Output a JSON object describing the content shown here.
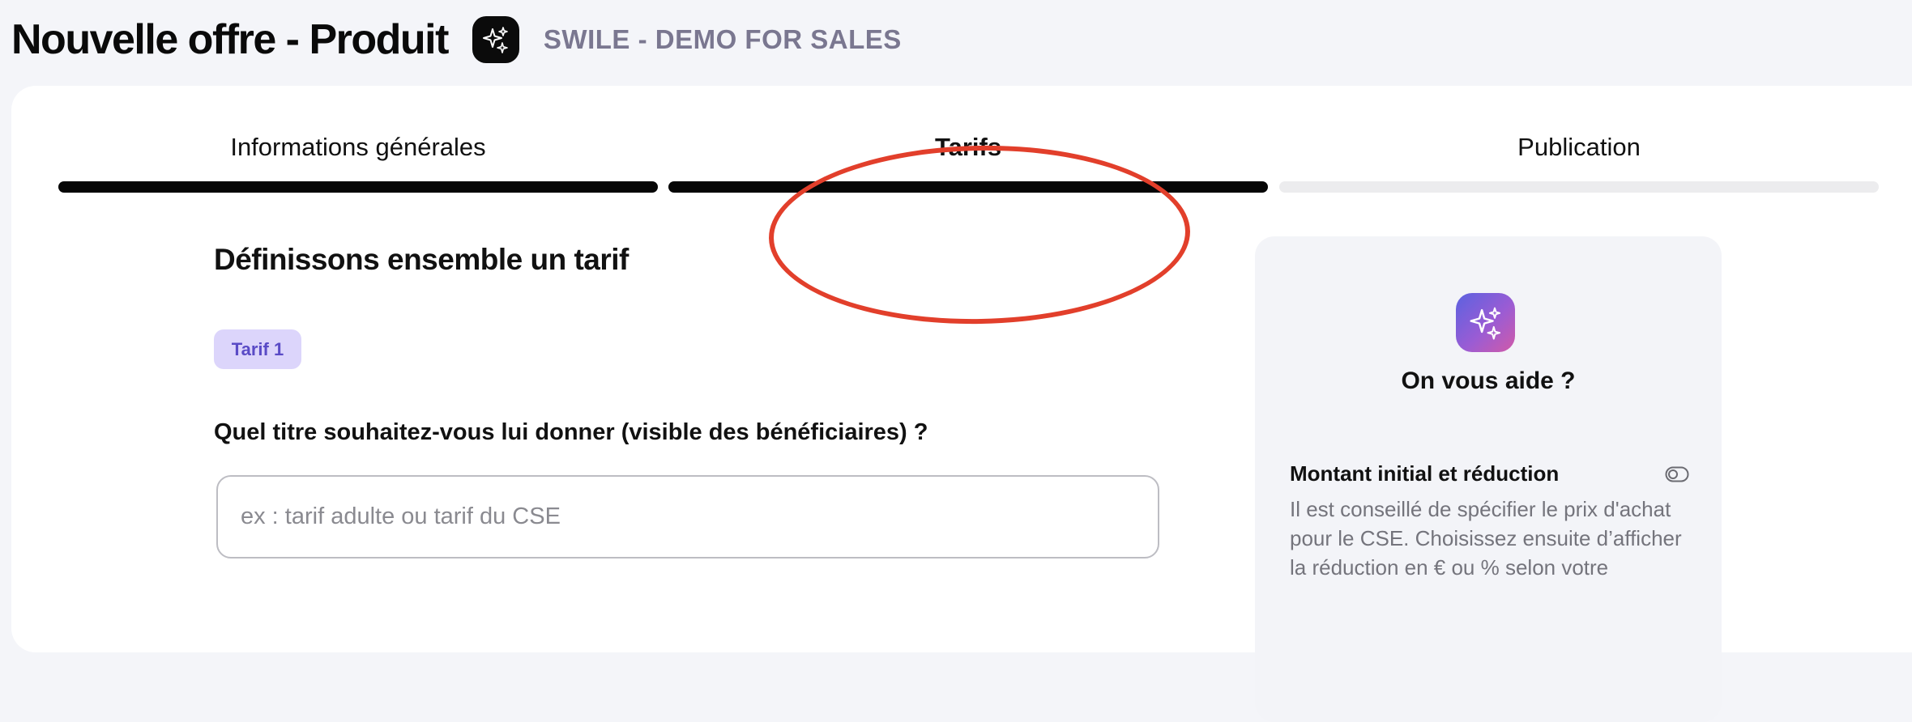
{
  "header": {
    "page_title": "Nouvelle offre - Produit",
    "company_name": "SWILE - DEMO FOR SALES",
    "brand_icon": "sparkles-icon"
  },
  "steps": [
    {
      "label": "Informations générales",
      "state": "completed"
    },
    {
      "label": "Tarifs",
      "state": "active"
    },
    {
      "label": "Publication",
      "state": "pending"
    }
  ],
  "form": {
    "section_title": "Définissons ensemble un tarif",
    "tarif_chip": "Tarif 1",
    "question": "Quel titre souhaitez-vous lui donner (visible des bénéficiaires) ?",
    "title_input": {
      "value": "",
      "placeholder": "ex : tarif adulte ou tarif du CSE"
    }
  },
  "help": {
    "icon": "sparkles-icon",
    "title": "On vous aide ?",
    "subtitle": "Montant initial et réduction",
    "toggle_icon": "toggle-icon",
    "text": "Il est conseillé de spécifier le prix d'achat pour le CSE. Choisissez ensuite d’afficher la réduction en € ou % selon votre"
  },
  "colors": {
    "accent_chip_bg": "#dcd5fb",
    "accent_chip_text": "#5a4bc6",
    "annotation": "#e23f2b",
    "step_active": "#060606",
    "step_inactive": "#ececee"
  }
}
